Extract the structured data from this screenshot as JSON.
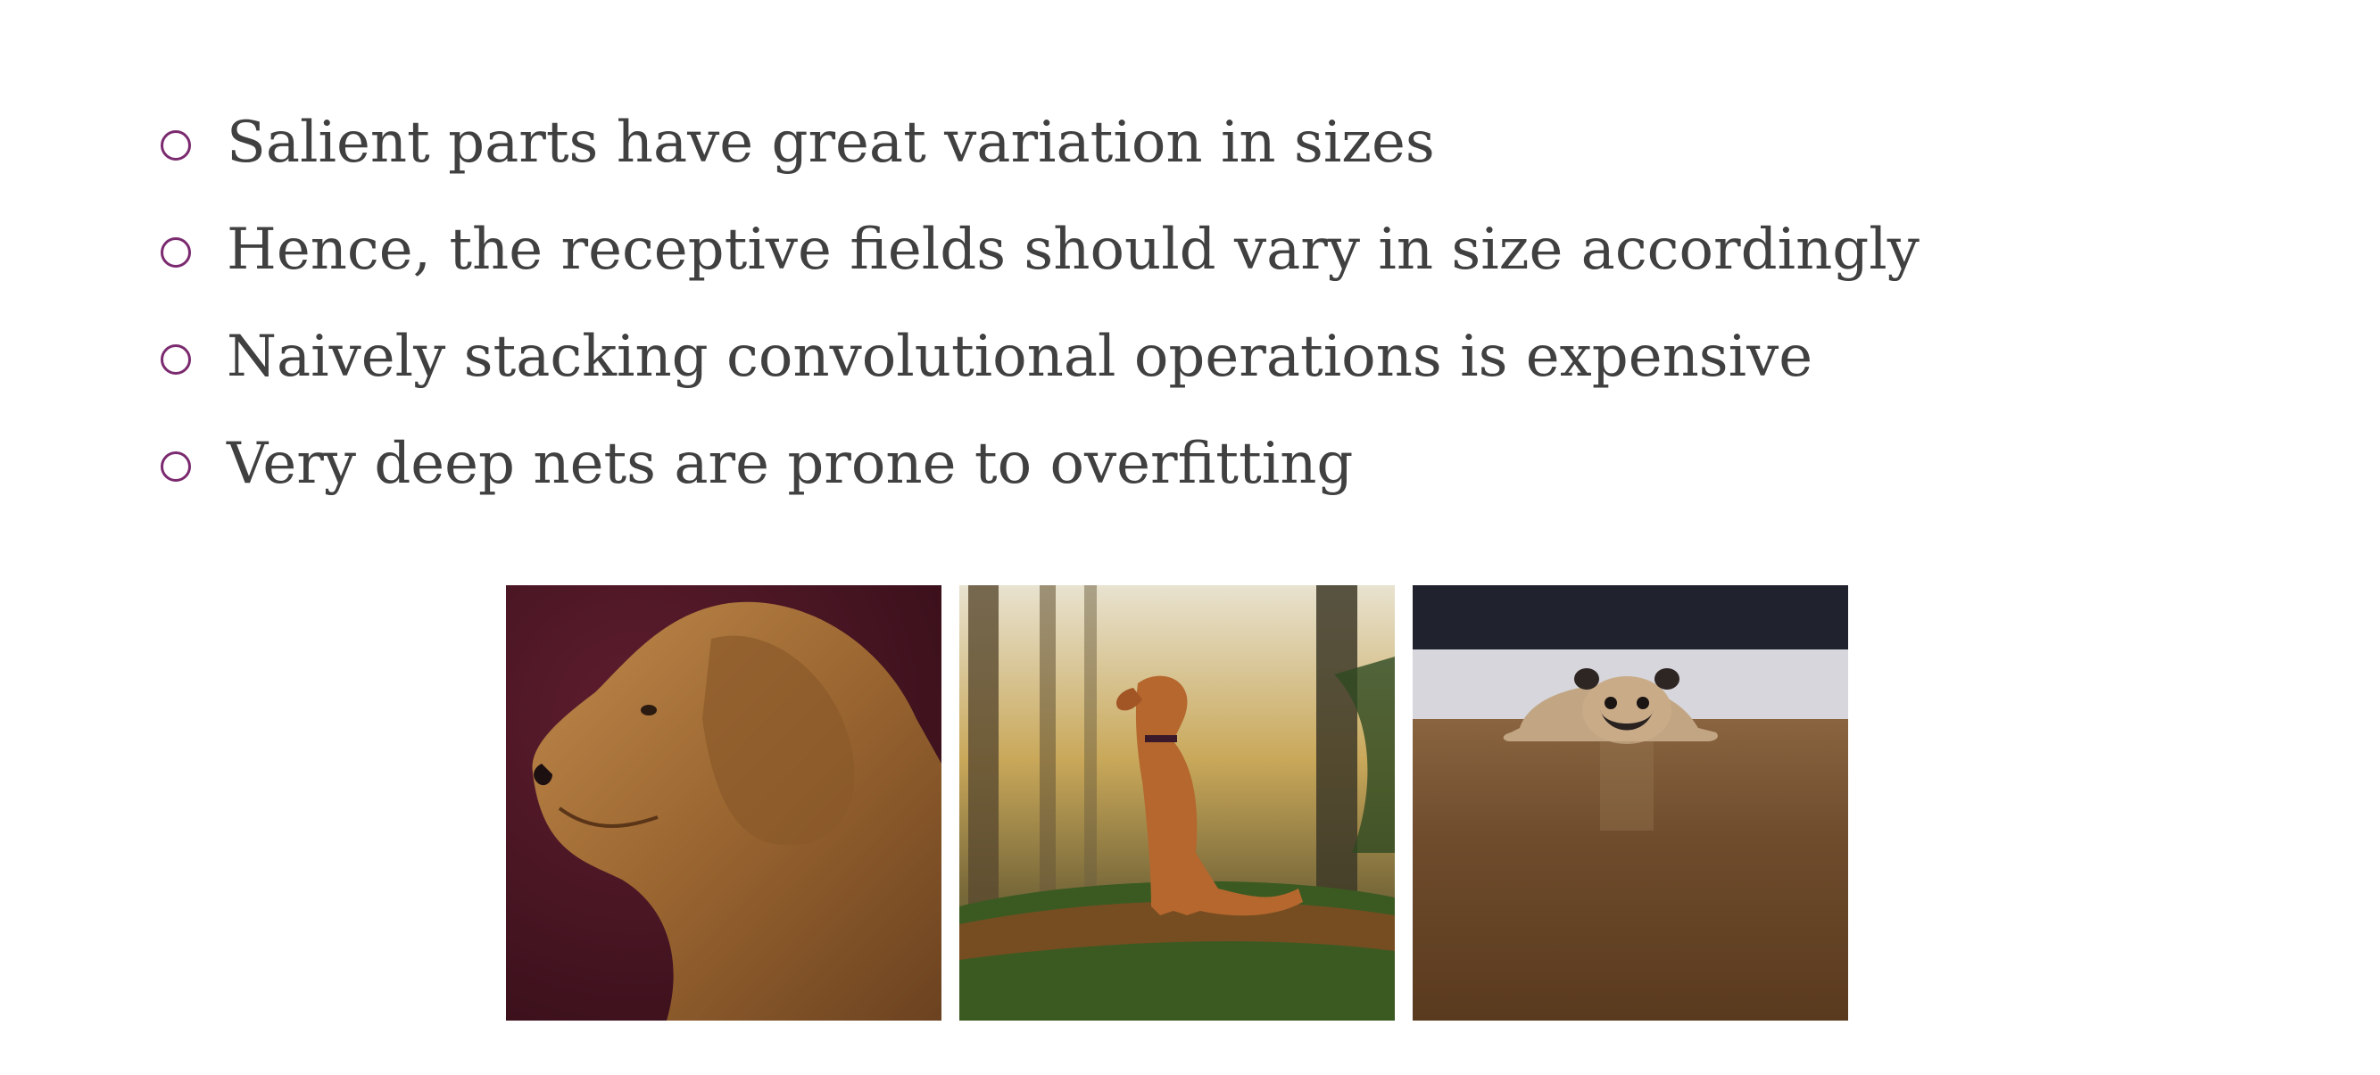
{
  "bullets": [
    {
      "text": "Salient parts have great variation in sizes"
    },
    {
      "text": "Hence, the receptive fields should vary in size accordingly"
    },
    {
      "text": "Naively stacking convolutional operations is expensive"
    },
    {
      "text": "Very deep nets are prone to overfitting"
    }
  ],
  "images": [
    {
      "subject": "golden-retriever-profile",
      "background": "#4a1624"
    },
    {
      "subject": "puppy-sitting-in-forest",
      "background": "#6b7a3a"
    },
    {
      "subject": "pug-lying-on-floor",
      "background": "#5c3d22"
    }
  ],
  "colors": {
    "text": "#404040",
    "bullet_marker": "#7b2a6f",
    "background": "#ffffff"
  }
}
